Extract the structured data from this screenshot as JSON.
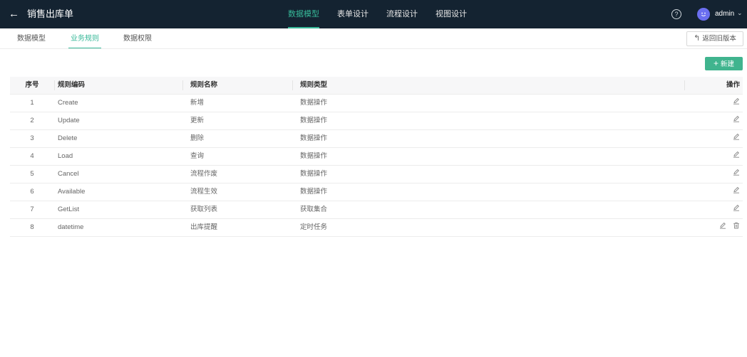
{
  "header": {
    "back_icon": "arrow-left-icon",
    "title": "销售出库单",
    "nav": [
      "数据模型",
      "表单设计",
      "流程设计",
      "视图设计"
    ],
    "nav_active": "数据模型",
    "help_icon": "question-circle-icon",
    "user": "admin"
  },
  "subtabs": {
    "items": [
      "数据模型",
      "业务规则",
      "数据权限"
    ],
    "active": "业务规则"
  },
  "return_button": "返回旧版本",
  "new_button": "新建",
  "colors": {
    "accent": "#36b898",
    "topbar": "#142331",
    "button_green": "#40b48e",
    "avatar": "#6b6ff0"
  },
  "table": {
    "columns": [
      "序号",
      "规则编码",
      "规则名称",
      "规则类型",
      "操作"
    ],
    "rows": [
      {
        "idx": "1",
        "code": "Create",
        "name": "新增",
        "type": "数据操作"
      },
      {
        "idx": "2",
        "code": "Update",
        "name": "更新",
        "type": "数据操作"
      },
      {
        "idx": "3",
        "code": "Delete",
        "name": "删除",
        "type": "数据操作"
      },
      {
        "idx": "4",
        "code": "Load",
        "name": "查询",
        "type": "数据操作"
      },
      {
        "idx": "5",
        "code": "Cancel",
        "name": "流程作废",
        "type": "数据操作"
      },
      {
        "idx": "6",
        "code": "Available",
        "name": "流程生效",
        "type": "数据操作"
      },
      {
        "idx": "7",
        "code": "GetList",
        "name": "获取列表",
        "type": "获取集合"
      },
      {
        "idx": "8",
        "code": "datetime",
        "name": "出库提醒",
        "type": "定时任务"
      }
    ]
  }
}
